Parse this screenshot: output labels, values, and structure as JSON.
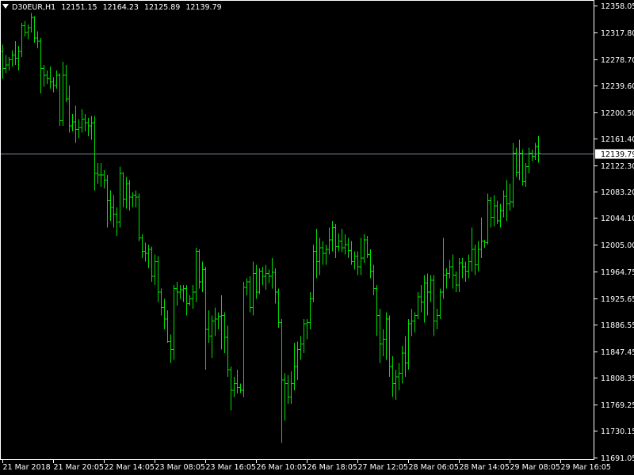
{
  "header": {
    "symbol": "D30EUR,H1",
    "open": "12151.15",
    "high": "12164.23",
    "low": "12125.89",
    "close": "12139.79"
  },
  "colors": {
    "background": "#000000",
    "bars": "#00e000",
    "axis": "#ffffff",
    "last_price_line": "#7f8fa0"
  },
  "chart_data": {
    "type": "ohlc",
    "timeframe": "H1",
    "y_ticks": [
      12358.05,
      12317.8,
      12278.7,
      12239.6,
      12200.5,
      12161.4,
      12122.3,
      12083.2,
      12044.1,
      12005.0,
      11964.75,
      11925.65,
      11886.55,
      11847.45,
      11808.35,
      11769.25,
      11730.15,
      11691.05
    ],
    "y_tick_labels": [
      "12358.05",
      "12317.80",
      "12278.70",
      "12239.60",
      "12200.50",
      "12161.40",
      "12122.30",
      "12083.20",
      "12044.10",
      "12005.00",
      "11964.75",
      "11925.65",
      "11886.55",
      "11847.45",
      "11808.35",
      "11769.25",
      "11730.15",
      "11691.05"
    ],
    "ylim": [
      11687,
      12366
    ],
    "x_labels": [
      "21 Mar 2018",
      "21 Mar 20:05",
      "22 Mar 14:05",
      "23 Mar 08:05",
      "23 Mar 16:05",
      "26 Mar 10:05",
      "26 Mar 18:05",
      "27 Mar 12:05",
      "28 Mar 06:05",
      "28 Mar 14:05",
      "29 Mar 08:05",
      "29 Mar 16:05"
    ],
    "x_label_bar_index": [
      0,
      16,
      32,
      48,
      64,
      80,
      96,
      112,
      128,
      144,
      160,
      176
    ],
    "last_price": 12139.79,
    "bars": [
      {
        "o": 12290,
        "h": 12300,
        "l": 12250,
        "c": 12265
      },
      {
        "o": 12265,
        "h": 12285,
        "l": 12258,
        "c": 12270
      },
      {
        "o": 12270,
        "h": 12282,
        "l": 12262,
        "c": 12278
      },
      {
        "o": 12278,
        "h": 12292,
        "l": 12268,
        "c": 12285
      },
      {
        "o": 12285,
        "h": 12305,
        "l": 12270,
        "c": 12280
      },
      {
        "o": 12280,
        "h": 12298,
        "l": 12262,
        "c": 12290
      },
      {
        "o": 12290,
        "h": 12332,
        "l": 12282,
        "c": 12328
      },
      {
        "o": 12328,
        "h": 12335,
        "l": 12312,
        "c": 12318
      },
      {
        "o": 12318,
        "h": 12330,
        "l": 12308,
        "c": 12325
      },
      {
        "o": 12325,
        "h": 12347,
        "l": 12318,
        "c": 12340
      },
      {
        "o": 12340,
        "h": 12342,
        "l": 12303,
        "c": 12310
      },
      {
        "o": 12310,
        "h": 12320,
        "l": 12295,
        "c": 12305
      },
      {
        "o": 12305,
        "h": 12310,
        "l": 12228,
        "c": 12265
      },
      {
        "o": 12265,
        "h": 12270,
        "l": 12238,
        "c": 12255
      },
      {
        "o": 12255,
        "h": 12262,
        "l": 12242,
        "c": 12250
      },
      {
        "o": 12250,
        "h": 12268,
        "l": 12235,
        "c": 12245
      },
      {
        "o": 12245,
        "h": 12252,
        "l": 12230,
        "c": 12240
      },
      {
        "o": 12240,
        "h": 12262,
        "l": 12235,
        "c": 12255
      },
      {
        "o": 12255,
        "h": 12258,
        "l": 12180,
        "c": 12188
      },
      {
        "o": 12188,
        "h": 12275,
        "l": 12180,
        "c": 12255
      },
      {
        "o": 12255,
        "h": 12270,
        "l": 12215,
        "c": 12220
      },
      {
        "o": 12220,
        "h": 12240,
        "l": 12170,
        "c": 12180
      },
      {
        "o": 12180,
        "h": 12198,
        "l": 12172,
        "c": 12186
      },
      {
        "o": 12186,
        "h": 12210,
        "l": 12155,
        "c": 12175
      },
      {
        "o": 12175,
        "h": 12190,
        "l": 12162,
        "c": 12178
      },
      {
        "o": 12178,
        "h": 12205,
        "l": 12170,
        "c": 12190
      },
      {
        "o": 12190,
        "h": 12198,
        "l": 12172,
        "c": 12185
      },
      {
        "o": 12185,
        "h": 12192,
        "l": 12165,
        "c": 12180
      },
      {
        "o": 12180,
        "h": 12195,
        "l": 12160,
        "c": 12185
      },
      {
        "o": 12185,
        "h": 12195,
        "l": 12085,
        "c": 12110
      },
      {
        "o": 12110,
        "h": 12125,
        "l": 12095,
        "c": 12108
      },
      {
        "o": 12108,
        "h": 12125,
        "l": 12090,
        "c": 12108
      },
      {
        "o": 12108,
        "h": 12115,
        "l": 12088,
        "c": 12100
      },
      {
        "o": 12100,
        "h": 12108,
        "l": 12030,
        "c": 12070
      },
      {
        "o": 12070,
        "h": 12085,
        "l": 12040,
        "c": 12060
      },
      {
        "o": 12060,
        "h": 12078,
        "l": 12030,
        "c": 12050
      },
      {
        "o": 12050,
        "h": 12060,
        "l": 12018,
        "c": 12038
      },
      {
        "o": 12038,
        "h": 12120,
        "l": 12030,
        "c": 12110
      },
      {
        "o": 12110,
        "h": 12112,
        "l": 12060,
        "c": 12072
      },
      {
        "o": 12072,
        "h": 12105,
        "l": 12058,
        "c": 12095
      },
      {
        "o": 12095,
        "h": 12100,
        "l": 12055,
        "c": 12075
      },
      {
        "o": 12075,
        "h": 12082,
        "l": 12060,
        "c": 12078
      },
      {
        "o": 12078,
        "h": 12085,
        "l": 12060,
        "c": 12075
      },
      {
        "o": 12075,
        "h": 12080,
        "l": 12010,
        "c": 12015
      },
      {
        "o": 12015,
        "h": 12020,
        "l": 11985,
        "c": 11995
      },
      {
        "o": 11995,
        "h": 12008,
        "l": 11980,
        "c": 11992
      },
      {
        "o": 11992,
        "h": 12005,
        "l": 11970,
        "c": 11998
      },
      {
        "o": 11998,
        "h": 12002,
        "l": 11950,
        "c": 11958
      },
      {
        "o": 11958,
        "h": 11990,
        "l": 11945,
        "c": 11980
      },
      {
        "o": 11980,
        "h": 11988,
        "l": 11920,
        "c": 11935
      },
      {
        "o": 11935,
        "h": 11940,
        "l": 11900,
        "c": 11912
      },
      {
        "o": 11912,
        "h": 11925,
        "l": 11880,
        "c": 11895
      },
      {
        "o": 11895,
        "h": 11908,
        "l": 11860,
        "c": 11862
      },
      {
        "o": 11862,
        "h": 11872,
        "l": 11830,
        "c": 11850
      },
      {
        "o": 11850,
        "h": 11945,
        "l": 11835,
        "c": 11940
      },
      {
        "o": 11940,
        "h": 11950,
        "l": 11915,
        "c": 11935
      },
      {
        "o": 11935,
        "h": 11945,
        "l": 11925,
        "c": 11938
      },
      {
        "o": 11938,
        "h": 11945,
        "l": 11920,
        "c": 11940
      },
      {
        "o": 11940,
        "h": 11945,
        "l": 11900,
        "c": 11918
      },
      {
        "o": 11918,
        "h": 11930,
        "l": 11915,
        "c": 11925
      },
      {
        "o": 11925,
        "h": 11945,
        "l": 11910,
        "c": 11935
      },
      {
        "o": 11935,
        "h": 12000,
        "l": 11920,
        "c": 11995
      },
      {
        "o": 11995,
        "h": 11998,
        "l": 11940,
        "c": 11950
      },
      {
        "o": 11950,
        "h": 11980,
        "l": 11935,
        "c": 11968
      },
      {
        "o": 11968,
        "h": 11972,
        "l": 11820,
        "c": 11880
      },
      {
        "o": 11880,
        "h": 11908,
        "l": 11860,
        "c": 11870
      },
      {
        "o": 11870,
        "h": 11900,
        "l": 11838,
        "c": 11892
      },
      {
        "o": 11892,
        "h": 11912,
        "l": 11870,
        "c": 11895
      },
      {
        "o": 11895,
        "h": 11905,
        "l": 11880,
        "c": 11899
      },
      {
        "o": 11899,
        "h": 11930,
        "l": 11850,
        "c": 11900
      },
      {
        "o": 11900,
        "h": 11905,
        "l": 11845,
        "c": 11868
      },
      {
        "o": 11868,
        "h": 11885,
        "l": 11810,
        "c": 11820
      },
      {
        "o": 11820,
        "h": 11825,
        "l": 11760,
        "c": 11790
      },
      {
        "o": 11790,
        "h": 11810,
        "l": 11780,
        "c": 11800
      },
      {
        "o": 11800,
        "h": 11820,
        "l": 11785,
        "c": 11794
      },
      {
        "o": 11794,
        "h": 11800,
        "l": 11786,
        "c": 11790
      },
      {
        "o": 11790,
        "h": 11950,
        "l": 11780,
        "c": 11942
      },
      {
        "o": 11942,
        "h": 11955,
        "l": 11930,
        "c": 11950
      },
      {
        "o": 11950,
        "h": 11958,
        "l": 11905,
        "c": 11912
      },
      {
        "o": 11912,
        "h": 11980,
        "l": 11900,
        "c": 11962
      },
      {
        "o": 11962,
        "h": 11975,
        "l": 11925,
        "c": 11935
      },
      {
        "o": 11935,
        "h": 11970,
        "l": 11932,
        "c": 11966
      },
      {
        "o": 11966,
        "h": 11972,
        "l": 11945,
        "c": 11958
      },
      {
        "o": 11958,
        "h": 11975,
        "l": 11938,
        "c": 11962
      },
      {
        "o": 11962,
        "h": 11968,
        "l": 11948,
        "c": 11958
      },
      {
        "o": 11958,
        "h": 11985,
        "l": 11940,
        "c": 11964
      },
      {
        "o": 11964,
        "h": 11970,
        "l": 11918,
        "c": 11935
      },
      {
        "o": 11935,
        "h": 11940,
        "l": 11882,
        "c": 11890
      },
      {
        "o": 11890,
        "h": 11895,
        "l": 11712,
        "c": 11805
      },
      {
        "o": 11805,
        "h": 11815,
        "l": 11745,
        "c": 11800
      },
      {
        "o": 11800,
        "h": 11812,
        "l": 11770,
        "c": 11780
      },
      {
        "o": 11780,
        "h": 11818,
        "l": 11770,
        "c": 11800
      },
      {
        "o": 11800,
        "h": 11860,
        "l": 11790,
        "c": 11825
      },
      {
        "o": 11825,
        "h": 11862,
        "l": 11805,
        "c": 11850
      },
      {
        "o": 11850,
        "h": 11870,
        "l": 11835,
        "c": 11858
      },
      {
        "o": 11858,
        "h": 11895,
        "l": 11845,
        "c": 11888
      },
      {
        "o": 11888,
        "h": 11895,
        "l": 11865,
        "c": 11890
      },
      {
        "o": 11890,
        "h": 11935,
        "l": 11880,
        "c": 11925
      },
      {
        "o": 11925,
        "h": 12005,
        "l": 11920,
        "c": 11995
      },
      {
        "o": 11995,
        "h": 12028,
        "l": 11955,
        "c": 11980
      },
      {
        "o": 11980,
        "h": 12015,
        "l": 11960,
        "c": 12000
      },
      {
        "o": 12000,
        "h": 12010,
        "l": 11975,
        "c": 11992
      },
      {
        "o": 11992,
        "h": 12005,
        "l": 11975,
        "c": 11998
      },
      {
        "o": 11998,
        "h": 12030,
        "l": 11990,
        "c": 12012
      },
      {
        "o": 12012,
        "h": 12040,
        "l": 11995,
        "c": 12030
      },
      {
        "o": 12030,
        "h": 12035,
        "l": 11985,
        "c": 12002
      },
      {
        "o": 12002,
        "h": 12022,
        "l": 11995,
        "c": 12010
      },
      {
        "o": 12010,
        "h": 12028,
        "l": 11994,
        "c": 12000
      },
      {
        "o": 12000,
        "h": 12020,
        "l": 11990,
        "c": 12005
      },
      {
        "o": 12005,
        "h": 12015,
        "l": 11985,
        "c": 11996
      },
      {
        "o": 11996,
        "h": 12010,
        "l": 11975,
        "c": 11980
      },
      {
        "o": 11980,
        "h": 11995,
        "l": 11968,
        "c": 11988
      },
      {
        "o": 11988,
        "h": 11995,
        "l": 11960,
        "c": 11972
      },
      {
        "o": 11972,
        "h": 12015,
        "l": 11960,
        "c": 11985
      },
      {
        "o": 11985,
        "h": 12020,
        "l": 11978,
        "c": 12012
      },
      {
        "o": 12012,
        "h": 12018,
        "l": 11985,
        "c": 11990
      },
      {
        "o": 11990,
        "h": 11998,
        "l": 11955,
        "c": 11966
      },
      {
        "o": 11966,
        "h": 11975,
        "l": 11930,
        "c": 11940
      },
      {
        "o": 11940,
        "h": 11945,
        "l": 11870,
        "c": 11900
      },
      {
        "o": 11900,
        "h": 11910,
        "l": 11830,
        "c": 11858
      },
      {
        "o": 11858,
        "h": 11880,
        "l": 11840,
        "c": 11865
      },
      {
        "o": 11865,
        "h": 11905,
        "l": 11835,
        "c": 11895
      },
      {
        "o": 11895,
        "h": 11900,
        "l": 11810,
        "c": 11825
      },
      {
        "o": 11825,
        "h": 11840,
        "l": 11780,
        "c": 11800
      },
      {
        "o": 11800,
        "h": 11820,
        "l": 11776,
        "c": 11810
      },
      {
        "o": 11810,
        "h": 11830,
        "l": 11790,
        "c": 11815
      },
      {
        "o": 11815,
        "h": 11855,
        "l": 11800,
        "c": 11845
      },
      {
        "o": 11845,
        "h": 11870,
        "l": 11810,
        "c": 11830
      },
      {
        "o": 11830,
        "h": 11895,
        "l": 11820,
        "c": 11888
      },
      {
        "o": 11888,
        "h": 11910,
        "l": 11870,
        "c": 11892
      },
      {
        "o": 11892,
        "h": 11905,
        "l": 11875,
        "c": 11900
      },
      {
        "o": 11900,
        "h": 11935,
        "l": 11895,
        "c": 11928
      },
      {
        "o": 11928,
        "h": 11945,
        "l": 11905,
        "c": 11920
      },
      {
        "o": 11920,
        "h": 11960,
        "l": 11890,
        "c": 11948
      },
      {
        "o": 11948,
        "h": 11962,
        "l": 11900,
        "c": 11935
      },
      {
        "o": 11935,
        "h": 11960,
        "l": 11920,
        "c": 11952
      },
      {
        "o": 11952,
        "h": 11960,
        "l": 11870,
        "c": 11892
      },
      {
        "o": 11892,
        "h": 11910,
        "l": 11880,
        "c": 11900
      },
      {
        "o": 11900,
        "h": 11940,
        "l": 11895,
        "c": 11935
      },
      {
        "o": 11935,
        "h": 12015,
        "l": 11925,
        "c": 11960
      },
      {
        "o": 11960,
        "h": 11970,
        "l": 11940,
        "c": 11962
      },
      {
        "o": 11962,
        "h": 11982,
        "l": 11955,
        "c": 11972
      },
      {
        "o": 11972,
        "h": 11990,
        "l": 11940,
        "c": 11960
      },
      {
        "o": 11960,
        "h": 11965,
        "l": 11935,
        "c": 11945
      },
      {
        "o": 11945,
        "h": 11985,
        "l": 11935,
        "c": 11978
      },
      {
        "o": 11978,
        "h": 11985,
        "l": 11955,
        "c": 11972
      },
      {
        "o": 11972,
        "h": 11980,
        "l": 11950,
        "c": 11966
      },
      {
        "o": 11966,
        "h": 11990,
        "l": 11955,
        "c": 11980
      },
      {
        "o": 11980,
        "h": 12030,
        "l": 11965,
        "c": 11998
      },
      {
        "o": 11998,
        "h": 12005,
        "l": 11960,
        "c": 11975
      },
      {
        "o": 11975,
        "h": 12010,
        "l": 11965,
        "c": 11998
      },
      {
        "o": 11998,
        "h": 12045,
        "l": 11985,
        "c": 12010
      },
      {
        "o": 12010,
        "h": 12012,
        "l": 12000,
        "c": 12008
      },
      {
        "o": 12008,
        "h": 12080,
        "l": 12005,
        "c": 12070
      },
      {
        "o": 12070,
        "h": 12075,
        "l": 12030,
        "c": 12045
      },
      {
        "o": 12045,
        "h": 12078,
        "l": 12032,
        "c": 12062
      },
      {
        "o": 12062,
        "h": 12070,
        "l": 12035,
        "c": 12040
      },
      {
        "o": 12040,
        "h": 12065,
        "l": 12030,
        "c": 12055
      },
      {
        "o": 12055,
        "h": 12085,
        "l": 12045,
        "c": 12076
      },
      {
        "o": 12076,
        "h": 12100,
        "l": 12040,
        "c": 12065
      },
      {
        "o": 12065,
        "h": 12095,
        "l": 12055,
        "c": 12068
      },
      {
        "o": 12068,
        "h": 12155,
        "l": 12060,
        "c": 12140
      },
      {
        "o": 12140,
        "h": 12148,
        "l": 12105,
        "c": 12112
      },
      {
        "o": 12112,
        "h": 12160,
        "l": 12100,
        "c": 12140
      },
      {
        "o": 12140,
        "h": 12145,
        "l": 12092,
        "c": 12098
      },
      {
        "o": 12098,
        "h": 12125,
        "l": 12090,
        "c": 12120
      },
      {
        "o": 12120,
        "h": 12148,
        "l": 12110,
        "c": 12140
      },
      {
        "o": 12140,
        "h": 12145,
        "l": 12128,
        "c": 12135
      },
      {
        "o": 12135,
        "h": 12155,
        "l": 12130,
        "c": 12150
      },
      {
        "o": 12150,
        "h": 12165,
        "l": 12126,
        "c": 12140
      }
    ]
  }
}
